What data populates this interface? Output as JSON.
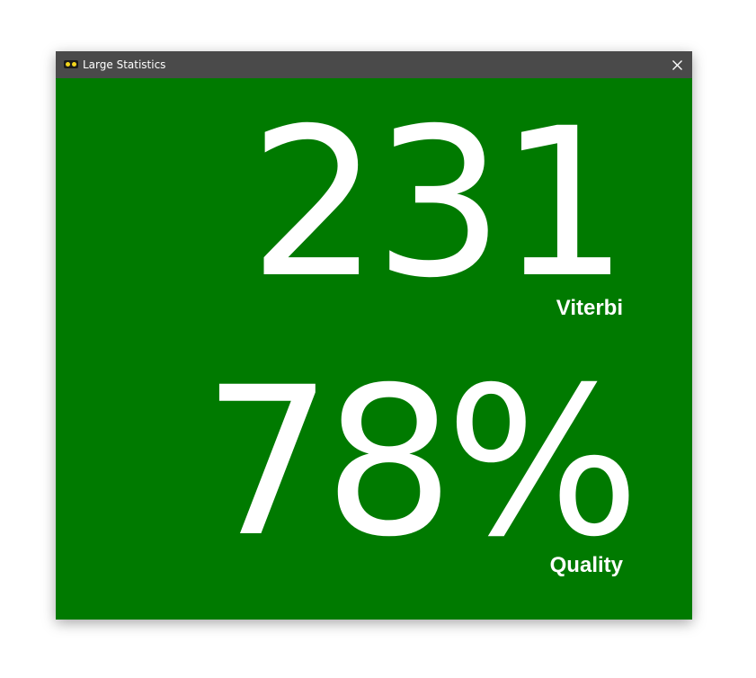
{
  "window": {
    "title": "Large Statistics",
    "icon": "app-glasses-icon",
    "close_icon": "close-icon"
  },
  "colors": {
    "background": "#007a00",
    "titlebar": "#4a4a4a",
    "text": "#ffffff",
    "icon_accent": "#f2d41c"
  },
  "stats": [
    {
      "value": "231",
      "label": "Viterbi"
    },
    {
      "value": "78%",
      "label": "Quality"
    }
  ]
}
